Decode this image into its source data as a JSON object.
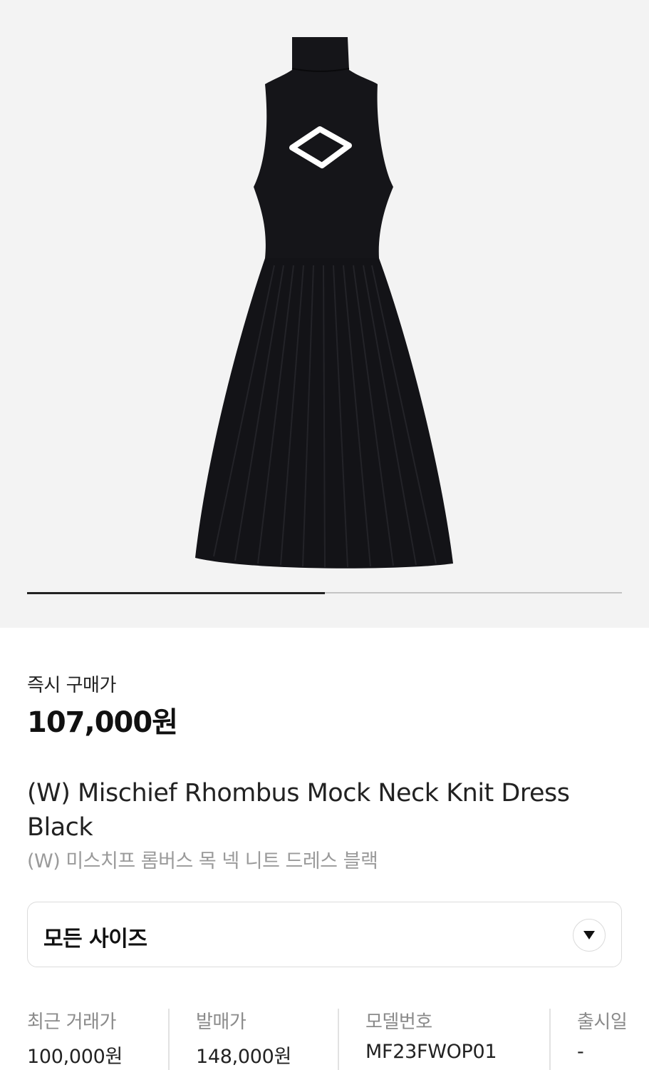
{
  "product_image": {
    "alt_icon": "dress-image",
    "carousel_progress": 0.5
  },
  "price_section": {
    "label": "즉시 구매가",
    "price": "107,000원"
  },
  "product": {
    "name_en": "(W) Mischief Rhombus Mock Neck Knit Dress Black",
    "name_ko": "(W) 미스치프 롬버스 목 넥 니트 드레스 블랙"
  },
  "size_select": {
    "label": "모든 사이즈",
    "icon": "chevron-down-icon"
  },
  "details": [
    {
      "label": "최근 거래가",
      "value": "100,000원"
    },
    {
      "label": "발매가",
      "value": "148,000원"
    },
    {
      "label": "모델번호",
      "value": "MF23FWOP01"
    },
    {
      "label": "출시일",
      "value": "-"
    }
  ],
  "colors": {
    "hero_bg": "#f3f3f3",
    "dress": "#151519",
    "text_primary": "#222222",
    "text_muted": "#9a9a9a",
    "border": "#dcdcdc"
  }
}
